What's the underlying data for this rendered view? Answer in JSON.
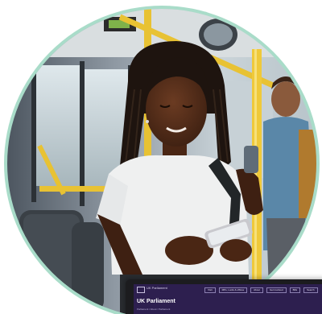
{
  "photo": {
    "subject": "woman-using-phone-on-bus",
    "ring_color": "#a9dcc9"
  },
  "website": {
    "logo_text": "UK Parliament",
    "title": "UK Parliament",
    "nav": [
      "Visit",
      "MPs, Lords & offices",
      "About",
      "Get involved",
      "Bills",
      "Search"
    ],
    "breadcrumb": "Parliament  /  About  /  Parliament",
    "accent": "#2d1f4f"
  }
}
